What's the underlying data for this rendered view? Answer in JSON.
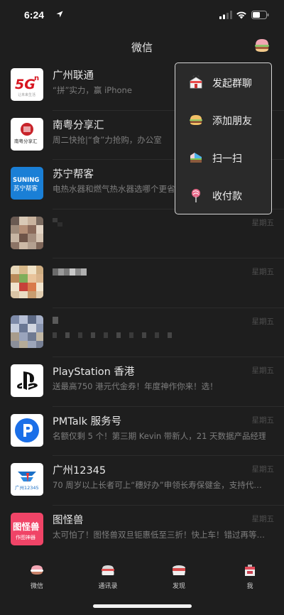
{
  "status": {
    "time": "6:24"
  },
  "nav": {
    "title": "微信"
  },
  "chats": [
    {
      "name": "广州联通",
      "msg": "“拼”实力，赢 iPhone",
      "time": ""
    },
    {
      "name": "南粤分享汇",
      "msg": "周二快抢|“食”力抢购，办公室",
      "time": ""
    },
    {
      "name": "苏宁帮客",
      "msg": "电热水器和燃气热水器选哪个更省",
      "time": ""
    },
    {
      "name": "",
      "msg": "",
      "time": "星期五"
    },
    {
      "name": "",
      "msg": "",
      "time": "星期五"
    },
    {
      "name": "",
      "msg": "",
      "time": "星期五"
    },
    {
      "name": "PlayStation 香港",
      "msg": "送最高750 港元代金券！年度神作你来！选！",
      "time": "星期五"
    },
    {
      "name": "PMTalk 服务号",
      "msg": "名额仅剩 5 个！第三期 Kevin 带新人，21 天数据产品经理训…",
      "time": "星期五"
    },
    {
      "name": "广州12345",
      "msg": "70 周岁以上长者可上“穗好办”申领长寿保健金，支持代…",
      "time": "星期五"
    },
    {
      "name": "图怪兽",
      "msg": "太可怕了！图怪兽双旦钜惠低至三折！快上车！错过再等…",
      "time": "星期五"
    }
  ],
  "avatar_text": {
    "unicom_5g": "5G",
    "unicom_n": "n",
    "unicom_sub": "让未来生活",
    "nanyue": "南粤分享汇",
    "suning_top": "SUNING",
    "suning_bottom": "苏宁帮客",
    "gz12345": "广州12345",
    "tgs_top": "图怪兽",
    "tgs_bottom": "作图神器"
  },
  "menu": [
    {
      "label": "发起群聊",
      "icon": "group-chat-icon"
    },
    {
      "label": "添加朋友",
      "icon": "add-friend-icon"
    },
    {
      "label": "扫一扫",
      "icon": "scan-icon"
    },
    {
      "label": "收付款",
      "icon": "payment-icon"
    }
  ],
  "tabs": [
    {
      "label": "微信",
      "icon": "chats-icon",
      "active": true
    },
    {
      "label": "通讯录",
      "icon": "contacts-icon",
      "active": false
    },
    {
      "label": "发现",
      "icon": "discover-icon",
      "active": false
    },
    {
      "label": "我",
      "icon": "me-icon",
      "active": false
    }
  ],
  "colors": {
    "background": "#1e1e1e",
    "popup_border": "#d7d7d7",
    "unicom_red": "#d7141f",
    "suning_blue": "#1a7fd6",
    "pmtalk_blue": "#1b6fe8",
    "tgs_pink": "#f04467"
  }
}
